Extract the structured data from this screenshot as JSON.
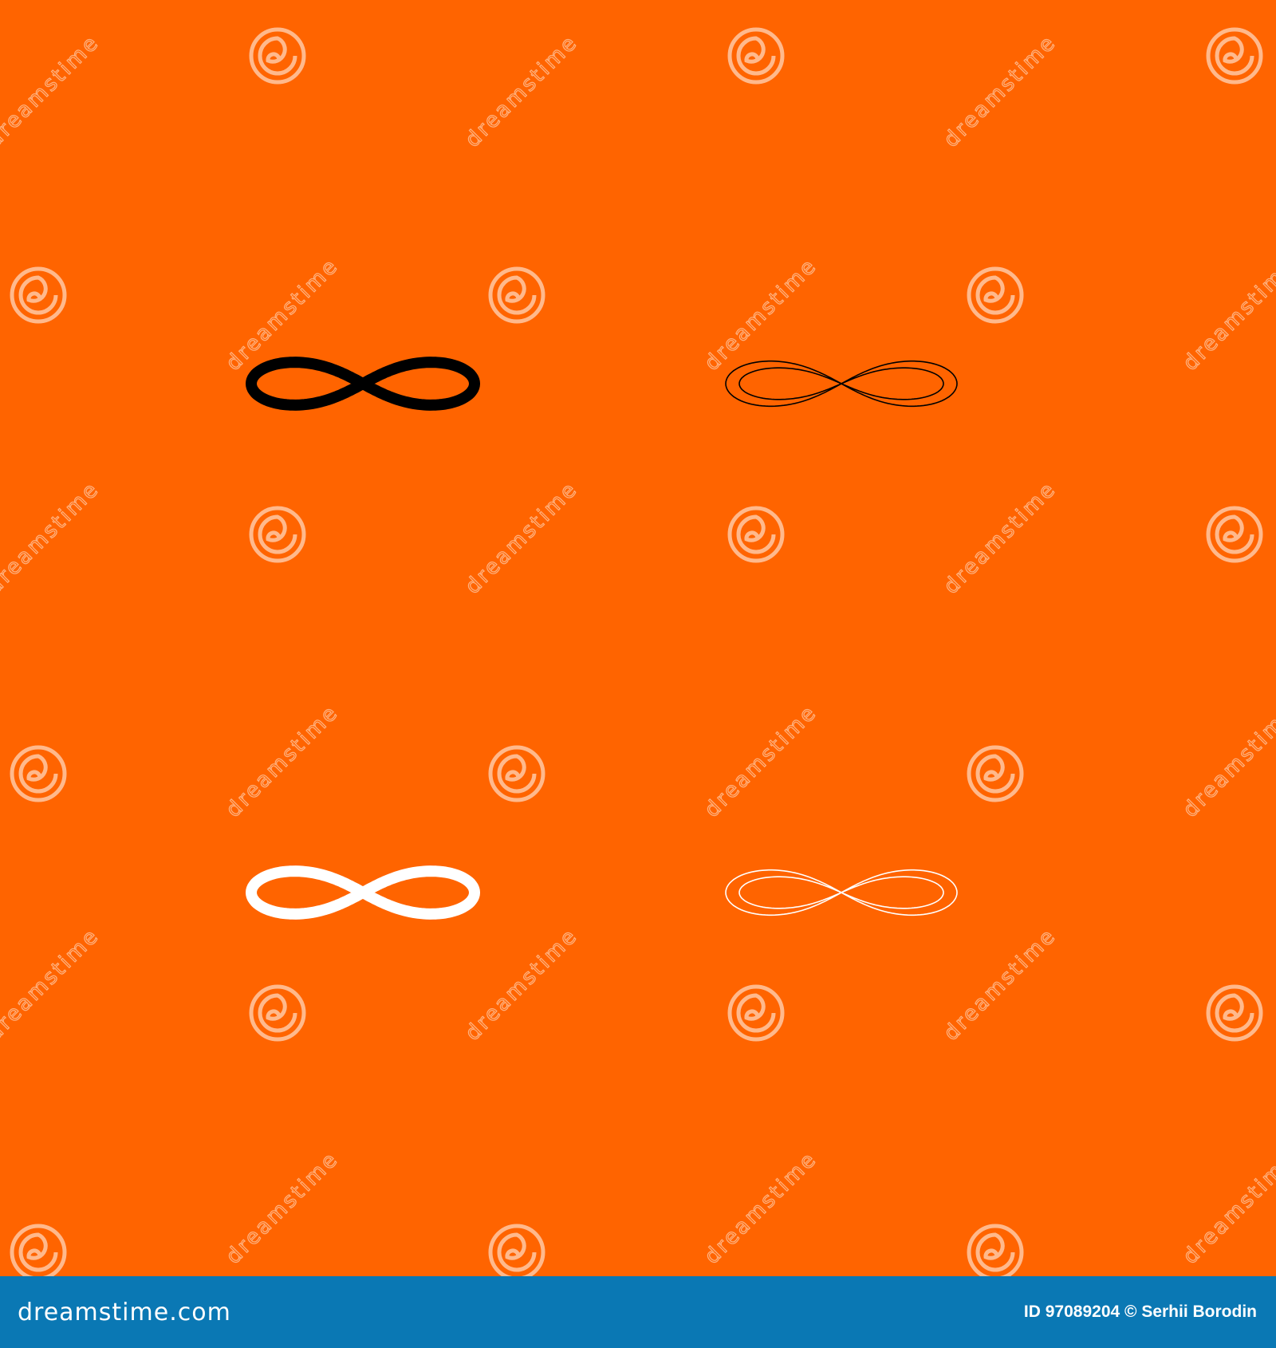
{
  "colors": {
    "background": "#ff6400",
    "footer": "#0a78b4",
    "icon_black": "#000000",
    "icon_white": "#ffffff"
  },
  "icons": [
    {
      "name": "infinity-icon",
      "style": "filled",
      "color": "black"
    },
    {
      "name": "infinity-icon",
      "style": "outline",
      "color": "black"
    },
    {
      "name": "infinity-icon",
      "style": "filled",
      "color": "white"
    },
    {
      "name": "infinity-icon",
      "style": "outline",
      "color": "white"
    }
  ],
  "watermark": {
    "text": "dreamstime",
    "icon": "dreamstime-spiral-icon"
  },
  "footer": {
    "brand": "dreamstime.com",
    "credit": "ID 97089204 © Serhii Borodin"
  }
}
